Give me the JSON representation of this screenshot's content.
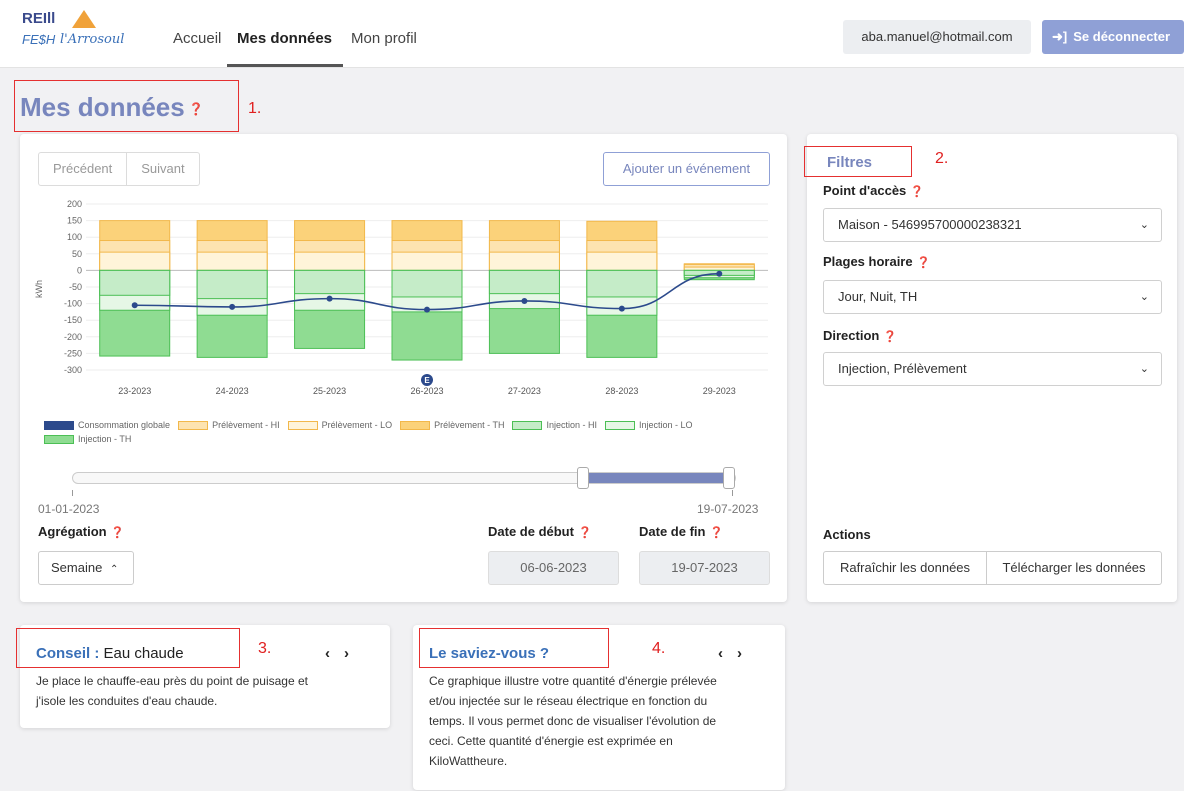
{
  "nav": {
    "logo_text": "REIll",
    "logo_sub": "FE$H",
    "logo_sub2": "l'Arrosoul",
    "links": [
      "Accueil",
      "Mes données",
      "Mon profil"
    ],
    "email": "aba.manuel@hotmail.com",
    "logout_label": "Se déconnecter"
  },
  "page": {
    "title": "Mes données"
  },
  "annotations": [
    "1.",
    "2.",
    "3.",
    "4."
  ],
  "chart_panel": {
    "prev_label": "Précédent",
    "next_label": "Suivant",
    "add_event_label": "Ajouter un événement",
    "date_start_label": "01-01-2023",
    "date_end_label": "19-07-2023",
    "aggregation_label": "Agrégation",
    "aggregation_value": "Semaine",
    "date_debut_label": "Date de début",
    "date_debut_value": "06-06-2023",
    "date_fin_label": "Date de fin",
    "date_fin_value": "19-07-2023",
    "range_selected": [
      0.72,
      1.0
    ]
  },
  "chart_data": {
    "type": "bar",
    "ylabel": "kWh",
    "ylim": [
      -300,
      200
    ],
    "yticks": [
      200,
      150,
      100,
      50,
      0,
      -50,
      -100,
      -150,
      -200,
      -250,
      -300
    ],
    "categories": [
      "23-2023",
      "24-2023",
      "25-2023",
      "26-2023",
      "27-2023",
      "28-2023",
      "29-2023"
    ],
    "event_marker": {
      "category": "26-2023",
      "label": "E"
    },
    "series": [
      {
        "name": "Prélèvement - HI",
        "values": [
          90,
          90,
          90,
          90,
          90,
          90,
          18
        ],
        "color": "#fde3b0"
      },
      {
        "name": "Prélèvement - LO",
        "values": [
          55,
          55,
          55,
          55,
          55,
          55,
          10
        ],
        "color": "#fff4d9"
      },
      {
        "name": "Prélèvement - TH",
        "values": [
          150,
          150,
          150,
          150,
          150,
          148,
          20
        ],
        "color": "#fbd27a"
      },
      {
        "name": "Injection - HI",
        "values": [
          -75,
          -85,
          -70,
          -80,
          -70,
          -80,
          -15
        ],
        "color": "#c5ecc8"
      },
      {
        "name": "Injection - LO",
        "values": [
          -120,
          -135,
          -120,
          -125,
          -115,
          -135,
          -22
        ],
        "color": "#e6f7e6"
      },
      {
        "name": "Injection - TH",
        "values": [
          -258,
          -262,
          -235,
          -270,
          -250,
          -262,
          -28
        ],
        "color": "#8fdc92"
      },
      {
        "name": "Consommation globale",
        "values": [
          -105,
          -110,
          -85,
          -118,
          -92,
          -115,
          -10
        ],
        "color": "#2c4a8c"
      }
    ],
    "legend": [
      "Consommation globale",
      "Prélèvement - HI",
      "Prélèvement - LO",
      "Prélèvement - TH",
      "Injection - HI",
      "Injection - LO",
      "Injection - TH"
    ]
  },
  "filters": {
    "title": "Filtres",
    "point_label": "Point d'accès",
    "point_value": "Maison - 546995700000238321",
    "plages_label": "Plages horaire",
    "plages_value": "Jour, Nuit, TH",
    "direction_label": "Direction",
    "direction_value": "Injection, Prélèvement",
    "actions_label": "Actions",
    "refresh_label": "Rafraîchir les données",
    "download_label": "Télécharger les données"
  },
  "conseil": {
    "title_prefix": "Conseil :",
    "title_value": "Eau chaude",
    "arrows": "‹›",
    "lines": [
      "Je place le chauffe-eau près du point de puisage et",
      "j'isole les conduites d'eau chaude."
    ]
  },
  "saviez": {
    "title": "Le saviez-vous ?",
    "arrows": "‹›",
    "lines": [
      "Ce graphique illustre votre quantité d'énergie prélevée",
      "et/ou injectée sur le réseau électrique en fonction du",
      "temps. Il vous permet donc de visualiser l'évolution de",
      "ceci. Cette quantité d'énergie est exprimée en",
      "KiloWattheure."
    ]
  }
}
